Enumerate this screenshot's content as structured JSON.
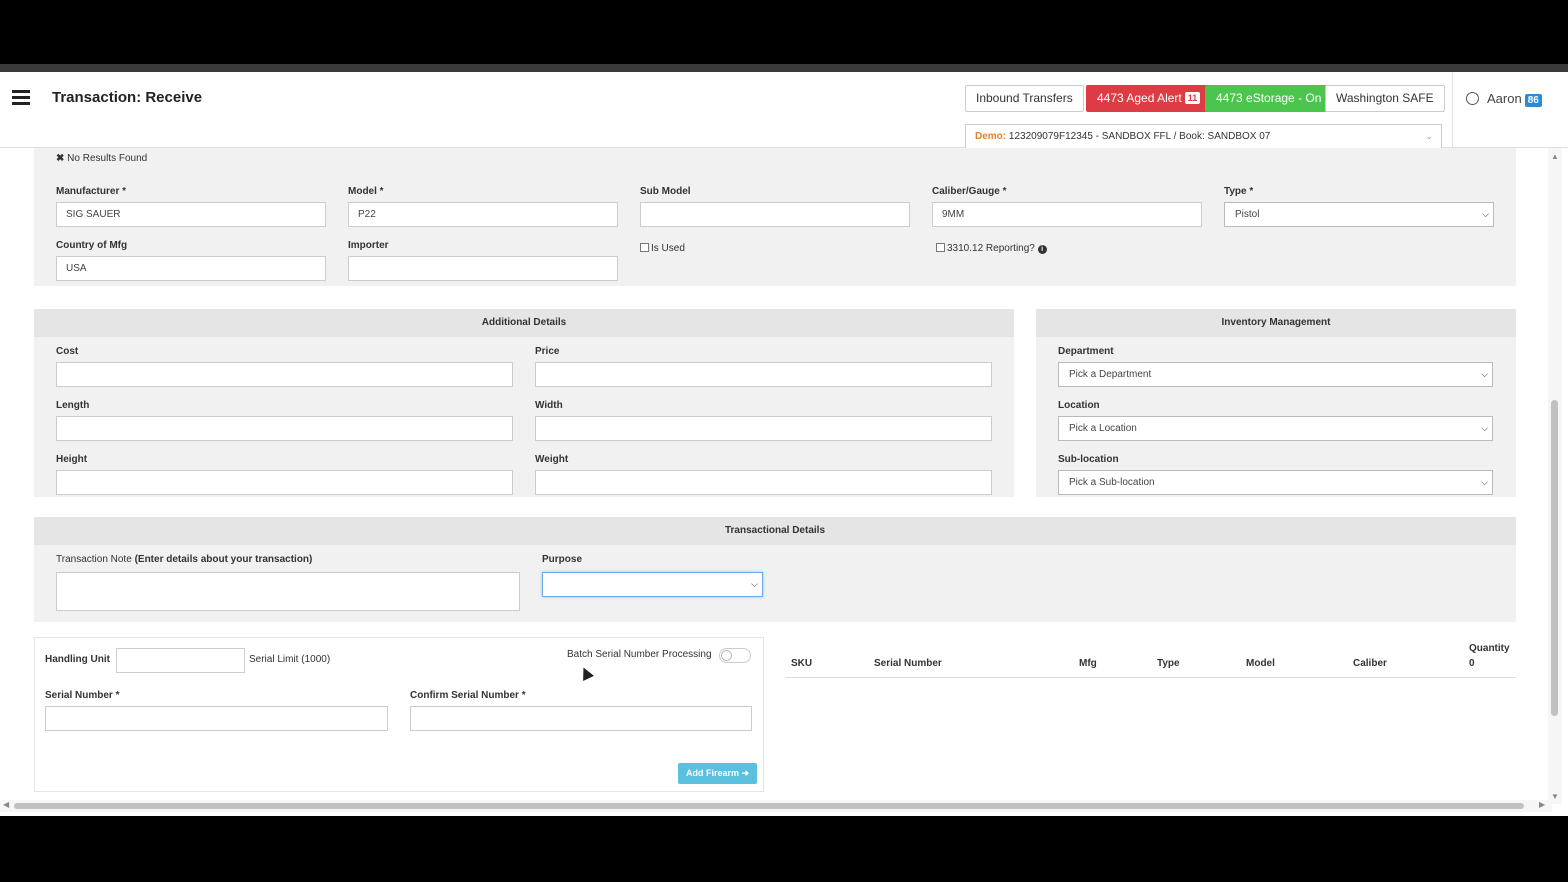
{
  "header": {
    "title": "Transaction: Receive",
    "buttons": {
      "inbound": "Inbound Transfers",
      "aged_alert": "4473 Aged Alert",
      "aged_count": "11",
      "estorage": "4473 eStorage - On",
      "state": "Washington SAFE"
    },
    "user": {
      "name": "Aaron",
      "badge": "86"
    },
    "book_select": {
      "prefix": "Demo:",
      "value": "123209079F12345 - SANDBOX FFL / Book: SANDBOX 07"
    }
  },
  "search_status": "No Results Found",
  "firearm": {
    "manufacturer": {
      "label": "Manufacturer *",
      "value": "SIG SAUER"
    },
    "model": {
      "label": "Model *",
      "value": "P22"
    },
    "sub_model": {
      "label": "Sub Model",
      "value": ""
    },
    "caliber": {
      "label": "Caliber/Gauge *",
      "value": "9MM"
    },
    "type": {
      "label": "Type *",
      "value": "Pistol"
    },
    "country": {
      "label": "Country of Mfg",
      "value": "USA"
    },
    "importer": {
      "label": "Importer",
      "value": ""
    },
    "is_used": "Is Used",
    "reporting": "3310.12 Reporting?"
  },
  "additional_details": {
    "title": "Additional Details",
    "cost": "Cost",
    "price": "Price",
    "length": "Length",
    "width": "Width",
    "height": "Height",
    "weight": "Weight"
  },
  "inventory": {
    "title": "Inventory Management",
    "department": {
      "label": "Department",
      "placeholder": "Pick a Department"
    },
    "location": {
      "label": "Location",
      "placeholder": "Pick a Location"
    },
    "sublocation": {
      "label": "Sub-location",
      "placeholder": "Pick a Sub-location"
    }
  },
  "transactional": {
    "title": "Transactional Details",
    "note_label": "Transaction Note",
    "note_hint": "(Enter details about your transaction)",
    "purpose_label": "Purpose",
    "purpose_value": ""
  },
  "serials": {
    "handling_unit": "Handling Unit",
    "serial_limit": "Serial Limit (1000)",
    "batch": "Batch Serial Number Processing",
    "serial_label": "Serial Number *",
    "confirm_label": "Confirm Serial Number *",
    "add_button": "Add Firearm"
  },
  "table": {
    "columns": [
      "SKU",
      "Serial Number",
      "Mfg",
      "Type",
      "Model",
      "Caliber"
    ],
    "quantity_label": "Quantity",
    "quantity_value": "0"
  },
  "colors": {
    "alert_red": "#dd3c44",
    "estorage_green": "#4cc54e",
    "user_badge_blue": "#2a8bd8",
    "demo_orange": "#e4812b",
    "add_button_blue": "#5bc0de"
  }
}
